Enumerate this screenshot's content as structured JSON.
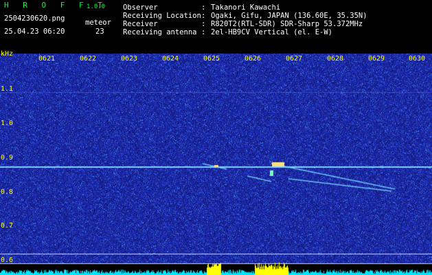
{
  "header": {
    "brand": "H R O F F T",
    "version": "1.0.0",
    "filename": "2504230620.png",
    "meteor_label": "meteor",
    "datetime": "25.04.23 06:20",
    "meteor_count": "23"
  },
  "info": [
    {
      "key": "Observer",
      "value": "Takanori Kawachi"
    },
    {
      "key": "Receiving Location",
      "value": "Ogaki, Gifu, JAPAN (136.60E, 35.35N)"
    },
    {
      "key": "Receiver",
      "value": "R820T2(RTL-SDR) SDR-Sharp 53.372MHz"
    },
    {
      "key": "Receiving antenna",
      "value": "2el-HB9CV Vertical (el. E-W)"
    }
  ],
  "axes": {
    "y_unit": "kHz",
    "x_ticks": [
      "0621",
      "0622",
      "0623",
      "0624",
      "0625",
      "0626",
      "0627",
      "0628",
      "0629",
      "0630"
    ],
    "y_ticks": [
      "1.1",
      "1.0",
      "0.9",
      "0.8",
      "0.7",
      "0.6"
    ]
  },
  "colors": {
    "background": "#1a1aa0",
    "header_text": "#ffffff",
    "header_accent": "#00ff3c",
    "axis_labels": "#ffff00",
    "carrier_line": "#7fd0ff",
    "histogram": "#00e5ff",
    "histogram_peak": "#ffff00"
  }
}
